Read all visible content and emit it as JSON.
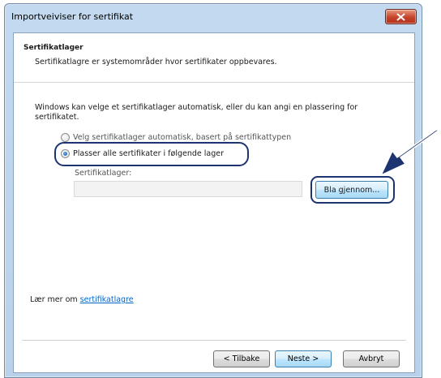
{
  "window": {
    "title": "Importveiviser for sertifikat"
  },
  "header": {
    "title": "Sertifikatlager",
    "description": "Sertifikatlagre er systemområder hvor sertifikater oppbevares."
  },
  "body": {
    "description": "Windows kan velge et sertifikatlager automatisk, eller du kan angi en plassering for sertifikatet.",
    "options": [
      {
        "label": "Velg sertifikatlager automatisk, basert på sertifikattypen",
        "checked": false
      },
      {
        "label": "Plasser alle sertifikater i følgende lager",
        "checked": true
      }
    ],
    "store_label": "Sertifikatlager:",
    "store_value": "",
    "browse_label": "Bla gjennom..."
  },
  "learn_more": {
    "prefix": "Lær mer om ",
    "link": "sertifikatlagre"
  },
  "footer": {
    "back_label": "< Tilbake",
    "next_label": "Neste >",
    "cancel_label": "Avbryt"
  },
  "colors": {
    "annotation": "#1e3470",
    "link": "#0066cc",
    "close_button": "#c5432b"
  }
}
